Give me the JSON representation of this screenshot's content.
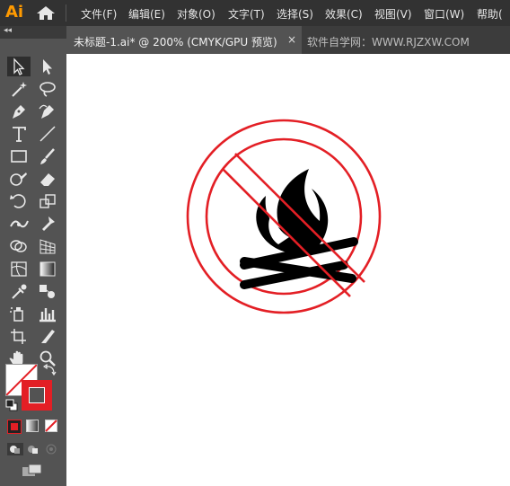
{
  "app": {
    "logo": "Ai"
  },
  "menu": {
    "items": [
      {
        "label": "文件(F)"
      },
      {
        "label": "编辑(E)"
      },
      {
        "label": "对象(O)"
      },
      {
        "label": "文字(T)"
      },
      {
        "label": "选择(S)"
      },
      {
        "label": "效果(C)"
      },
      {
        "label": "视图(V)"
      },
      {
        "label": "窗口(W)"
      },
      {
        "label": "帮助("
      }
    ]
  },
  "tabs": {
    "active": {
      "label": "未标题-1.ai* @ 200% (CMYK/GPU 预览)",
      "close": "×"
    },
    "watermark": "软件自学网：WWW.RJZXW.COM"
  },
  "panel": {
    "collapse": "◂◂"
  },
  "colors": {
    "stroke": "#e31f25",
    "fill": "none",
    "artwork_black": "#000000",
    "menubar": "#323232",
    "panel": "#535353",
    "canvas": "#ffffff"
  },
  "tools": [
    "selection-tool",
    "direct-selection-tool",
    "magic-wand-tool",
    "lasso-tool",
    "pen-tool",
    "curvature-tool",
    "type-tool",
    "line-segment-tool",
    "rectangle-tool",
    "paintbrush-tool",
    "shaper-tool",
    "eraser-tool",
    "rotate-tool",
    "scale-tool",
    "width-tool",
    "puppet-warp-tool",
    "shape-builder-tool",
    "perspective-grid-tool",
    "mesh-tool",
    "gradient-tool",
    "eyedropper-tool",
    "blend-tool",
    "symbol-sprayer-tool",
    "column-graph-tool",
    "artboard-tool",
    "slice-tool",
    "hand-tool",
    "zoom-tool"
  ]
}
